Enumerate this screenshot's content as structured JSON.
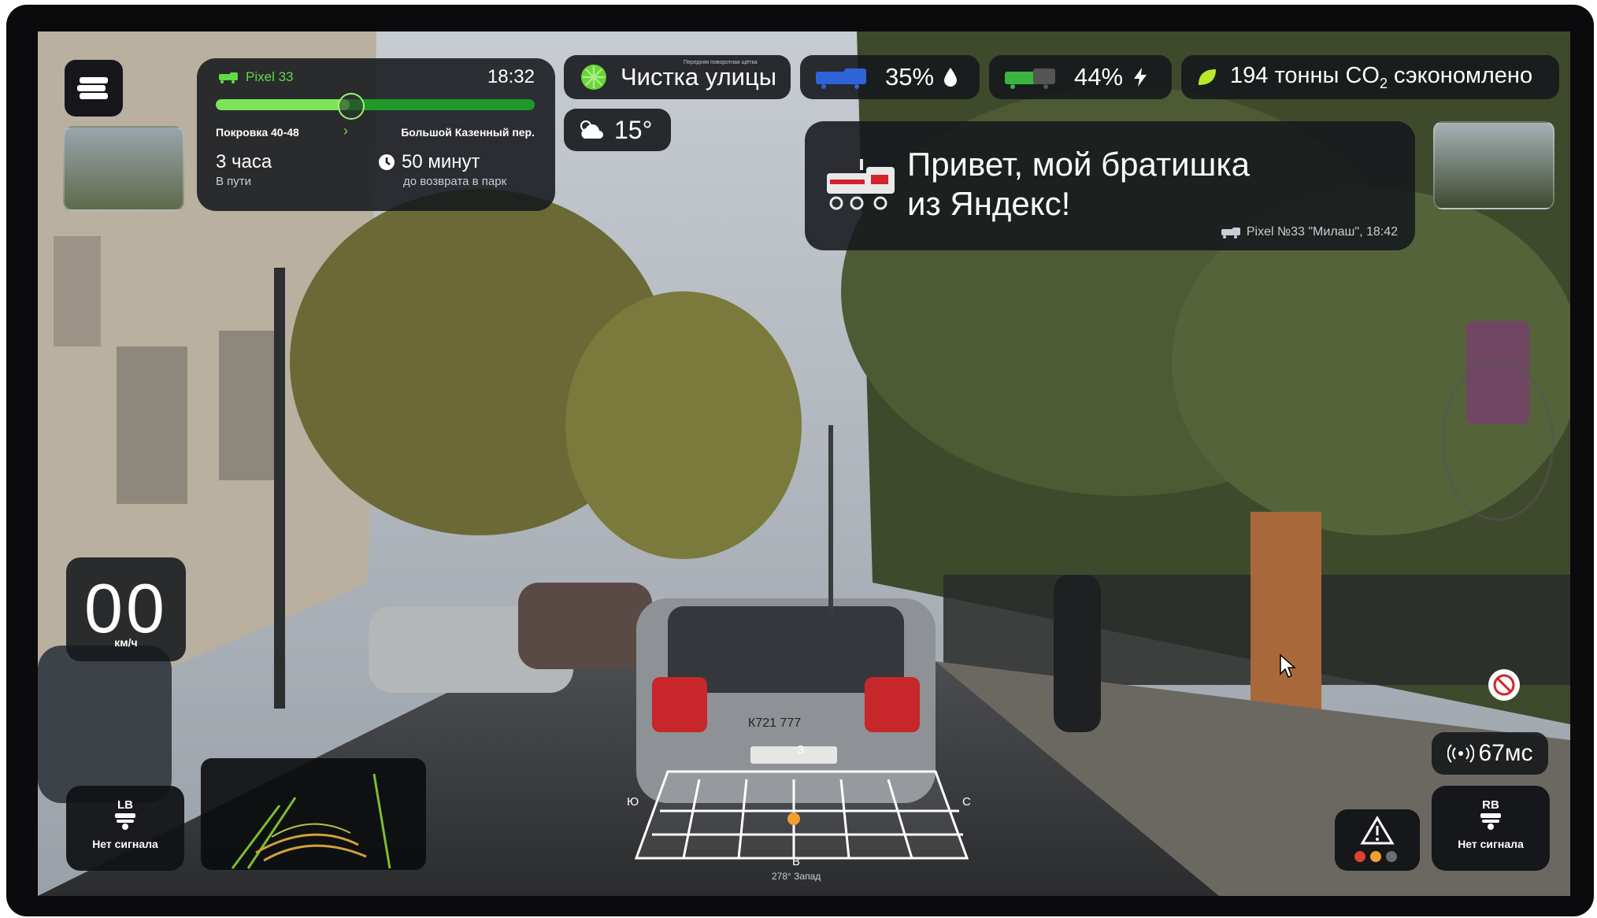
{
  "trip": {
    "robot_name": "Pixel 33",
    "time": "18:32",
    "progress_pct": 42,
    "from": "Покровка 40-48",
    "to": "Большой Казенный пер.",
    "duration": "3 часа",
    "duration_label": "В пути",
    "return_time": "50 минут",
    "return_label": "до возврата в парк"
  },
  "status": {
    "mode_caption": "Передняя поворотная щётка",
    "mode": "Чистка улицы",
    "water": "35%",
    "battery": "44%",
    "co2_prefix": "194 тонны CO",
    "co2_sub": "2",
    "co2_suffix": " сэкономлено",
    "temperature": "15°"
  },
  "message": {
    "line1": "Привет, мой братишка",
    "line2": "из Яндекс!",
    "signature": "Pixel №33 \"Милаш\", 18:42"
  },
  "speed": {
    "value": "00",
    "unit": "км/ч"
  },
  "buttons": {
    "lb_label": "LB",
    "lb_status": "Нет сигнала",
    "rb_label": "RB",
    "rb_status": "Нет сигнала"
  },
  "latency": "67мс",
  "compass": {
    "north": "З",
    "south": "В",
    "west": "Ю",
    "east": "С",
    "heading": "278° Запад"
  },
  "plate": "К721 777",
  "icons": [
    "logo-icon",
    "robot-icon",
    "clock-icon",
    "brush-icon",
    "weather-cloud-icon",
    "water-drop-icon",
    "lightning-icon",
    "leaf-icon",
    "warning-icon",
    "no-signal-icon",
    "wifi-signal-icon"
  ],
  "colors": {
    "accent_green": "#5fdc46",
    "bar_bg": "#1f9a2a",
    "pill_bg": "#16181c"
  }
}
